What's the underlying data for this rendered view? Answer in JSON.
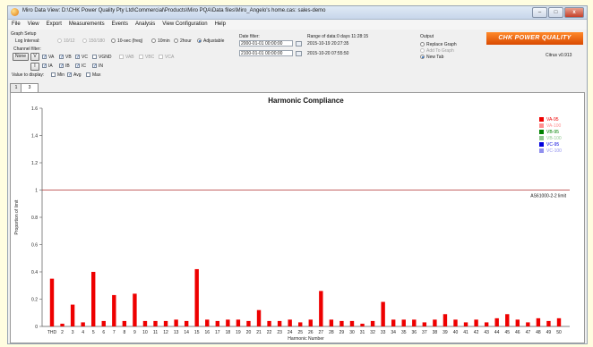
{
  "window": {
    "title": "Miro Data View: D:\\CHK Power Quality Pty Ltd\\Commercial\\Products\\Miro PQA\\Data files\\Miro_Angelo's home.cas: sales-demo",
    "minimize": "–",
    "maximize": "□",
    "close": "x"
  },
  "menu": [
    "File",
    "View",
    "Export",
    "Measurements",
    "Events",
    "Analysis",
    "View Configuration",
    "Help"
  ],
  "setup": {
    "group_label": "Graph Setup",
    "log_interval_label": "Log Interval:",
    "intervals": [
      {
        "label": "10/12",
        "checked": false,
        "enabled": false
      },
      {
        "label": "150/180",
        "checked": false,
        "enabled": false
      },
      {
        "label": "10-sec (freq)",
        "checked": false,
        "enabled": true
      },
      {
        "label": "10min",
        "checked": false,
        "enabled": true
      },
      {
        "label": "2hour",
        "checked": false,
        "enabled": true
      },
      {
        "label": "Adjustable",
        "checked": true,
        "enabled": true
      }
    ],
    "channel_filter_label": "Channel filter:",
    "none_button": "None",
    "v_button": "V",
    "i_button": "I",
    "channels_row1": [
      {
        "label": "VA",
        "checked": true,
        "enabled": true
      },
      {
        "label": "VB",
        "checked": true,
        "enabled": true
      },
      {
        "label": "VC",
        "checked": true,
        "enabled": true
      },
      {
        "label": "VGND",
        "checked": false,
        "enabled": true
      },
      {
        "label": "VAB",
        "checked": false,
        "enabled": false
      },
      {
        "label": "VBC",
        "checked": false,
        "enabled": false
      },
      {
        "label": "VCA",
        "checked": false,
        "enabled": false
      }
    ],
    "channels_row2": [
      {
        "label": "IA",
        "checked": true,
        "enabled": true
      },
      {
        "label": "IB",
        "checked": true,
        "enabled": true
      },
      {
        "label": "IC",
        "checked": true,
        "enabled": true
      },
      {
        "label": "IN",
        "checked": true,
        "enabled": true
      }
    ],
    "value_label": "Value to display:",
    "values": [
      {
        "label": "Min",
        "checked": false
      },
      {
        "label": "Avg",
        "checked": true
      },
      {
        "label": "Max",
        "checked": false
      }
    ],
    "date_filter_label": "Date filter:",
    "date_from": "2000-01-01 00:00:00",
    "date_to": "2100-01-01 00:00:00",
    "range_label": "Range of data:",
    "range_duration": "0 days 11:28:15",
    "range_start": "2015-10-19 20:27:35",
    "range_end": "2015-10-20 07:55:50",
    "output_label": "Output",
    "output_options": [
      {
        "label": "Replace Graph",
        "checked": false,
        "enabled": true
      },
      {
        "label": "Add To Graph",
        "checked": false,
        "enabled": false
      },
      {
        "label": "New Tab",
        "checked": true,
        "enabled": true
      }
    ],
    "brand": "CHK POWER QUALITY",
    "version": "Citrus v0.913"
  },
  "tabs": [
    {
      "label": "1",
      "active": false
    },
    {
      "label": "3",
      "active": true
    }
  ],
  "colors": {
    "bar": "#ee0000",
    "limit_line": "#b03030",
    "VA-95": "#ee0000",
    "VA-100": "#ff9090",
    "VB-95": "#008000",
    "VB-100": "#90c890",
    "VC-95": "#0000dd",
    "VC-100": "#9090ee"
  },
  "chart_data": {
    "type": "bar",
    "title": "Harmonic Compliance",
    "xlabel": "Harmonic Number",
    "ylabel": "Proportion of limit",
    "ylim": [
      0,
      1.6
    ],
    "yticks": [
      0,
      0.2,
      0.4,
      0.6,
      0.8,
      1,
      1.2,
      1.4,
      1.6
    ],
    "grid": false,
    "legend_position": "top-right",
    "limit_line": {
      "value": 1.0,
      "label": "AS61000-2-2 limit"
    },
    "legend": [
      "VA-95",
      "VA-100",
      "VB-95",
      "VB-100",
      "VC-95",
      "VC-100"
    ],
    "categories": [
      "THD",
      "2",
      "3",
      "4",
      "5",
      "6",
      "7",
      "8",
      "9",
      "10",
      "11",
      "12",
      "13",
      "14",
      "15",
      "16",
      "17",
      "18",
      "19",
      "20",
      "21",
      "22",
      "23",
      "24",
      "25",
      "26",
      "27",
      "28",
      "29",
      "30",
      "31",
      "32",
      "33",
      "34",
      "35",
      "36",
      "37",
      "38",
      "39",
      "40",
      "41",
      "42",
      "43",
      "44",
      "45",
      "46",
      "47",
      "48",
      "49",
      "50"
    ],
    "series": [
      {
        "name": "VA-95",
        "values": [
          0.35,
          0.02,
          0.16,
          0.03,
          0.4,
          0.04,
          0.23,
          0.04,
          0.24,
          0.04,
          0.04,
          0.04,
          0.05,
          0.04,
          0.42,
          0.05,
          0.04,
          0.05,
          0.05,
          0.04,
          0.12,
          0.04,
          0.04,
          0.05,
          0.03,
          0.05,
          0.26,
          0.05,
          0.04,
          0.04,
          0.02,
          0.04,
          0.18,
          0.05,
          0.05,
          0.05,
          0.03,
          0.05,
          0.09,
          0.05,
          0.03,
          0.05,
          0.03,
          0.06,
          0.09,
          0.05,
          0.03,
          0.06,
          0.04,
          0.06
        ]
      }
    ]
  }
}
